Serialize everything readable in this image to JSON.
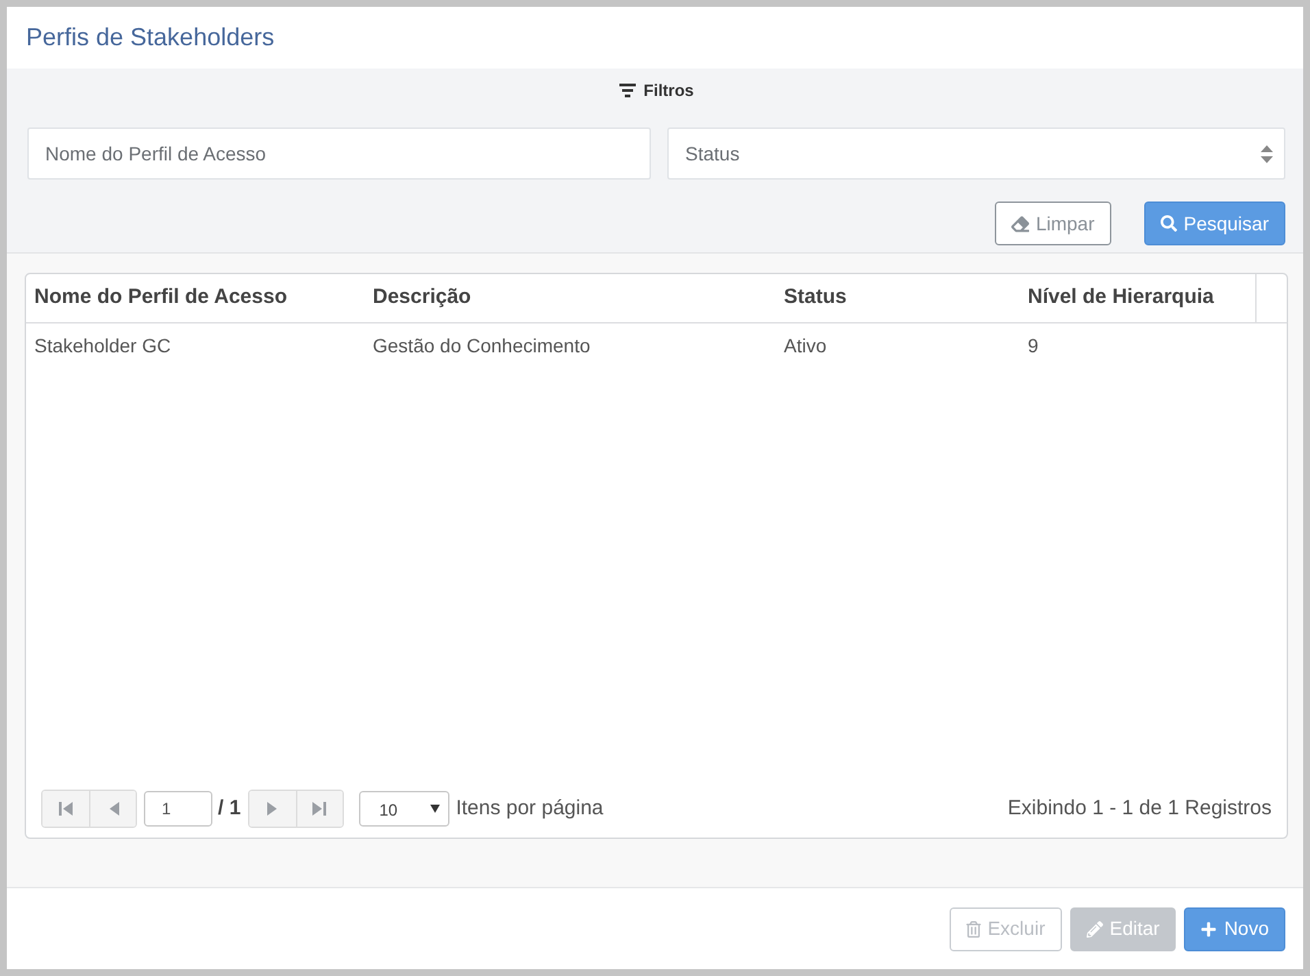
{
  "page": {
    "title": "Perfis de Stakeholders"
  },
  "filters": {
    "heading": "Filtros",
    "fields": [
      {
        "kind": "text",
        "placeholder": "Nome do Perfil de Acesso"
      },
      {
        "kind": "select",
        "placeholder": "Status"
      }
    ],
    "buttons": [
      {
        "kind": "clear",
        "label": "Limpar"
      },
      {
        "kind": "search",
        "label": "Pesquisar"
      }
    ]
  },
  "table": {
    "columns": [
      "Nome do Perfil de Acesso",
      "Descrição",
      "Status",
      "Nível de Hierarquia"
    ],
    "rows": [
      [
        "Stakeholder GC",
        "Gestão do Conhecimento",
        "Ativo",
        "9"
      ]
    ]
  },
  "pagination": {
    "nav": [
      {
        "kind": "first",
        "disabled": true
      },
      {
        "kind": "prev",
        "disabled": true
      },
      {
        "kind": "next",
        "disabled": true
      },
      {
        "kind": "last",
        "disabled": true
      }
    ],
    "page": "1",
    "total": "/ 1",
    "page_size": "10",
    "page_size_label": "Itens por página",
    "summary": "Exibindo 1 - 1 de 1 Registros"
  },
  "actions": [
    {
      "kind": "delete",
      "label": "Excluir",
      "disabled": true
    },
    {
      "kind": "edit",
      "label": "Editar",
      "disabled": true
    },
    {
      "kind": "new",
      "label": "Novo",
      "disabled": false
    }
  ]
}
